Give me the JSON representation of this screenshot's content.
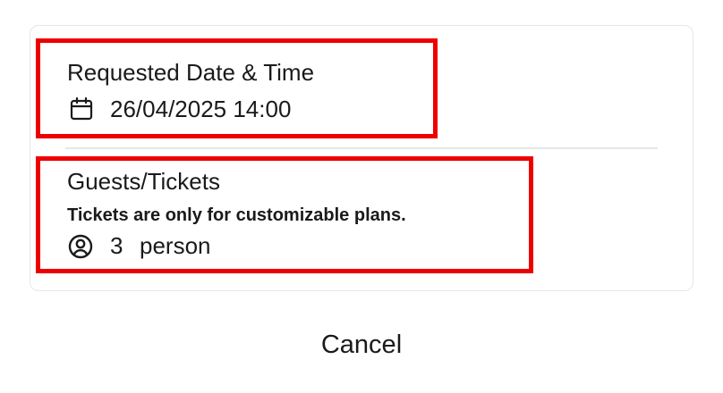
{
  "date_section": {
    "label": "Requested Date & Time",
    "value": "26/04/2025 14:00",
    "icon": "calendar-icon"
  },
  "guests_section": {
    "label": "Guests/Tickets",
    "note": "Tickets are only for customizable plans.",
    "count": "3",
    "unit": "person",
    "icon": "user-circle-icon"
  },
  "actions": {
    "cancel_label": "Cancel"
  },
  "colors": {
    "highlight": "#ee0000",
    "border": "#e3e6ea",
    "text": "#1a1a1a"
  }
}
